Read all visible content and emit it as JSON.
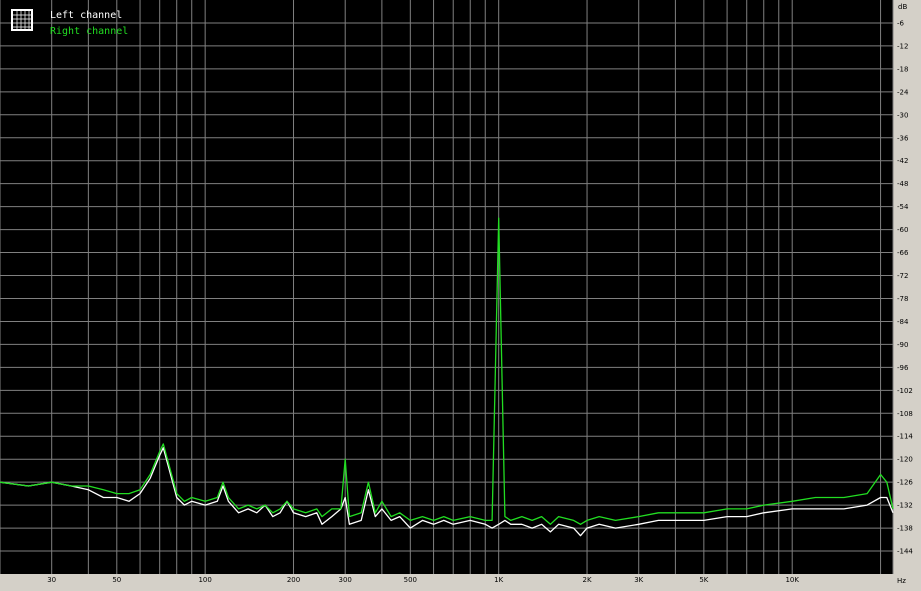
{
  "chart_data": {
    "type": "line",
    "y_unit": "dB",
    "x_unit": "Hz",
    "x_scale": "log",
    "xlim": [
      20,
      22050
    ],
    "ylim": [
      -150,
      0
    ],
    "y_ticks": [
      -6,
      -12,
      -18,
      -24,
      -30,
      -36,
      -42,
      -48,
      -54,
      -60,
      -66,
      -72,
      -78,
      -84,
      -90,
      -96,
      -102,
      -108,
      -114,
      -120,
      -126,
      -132,
      -138,
      -144
    ],
    "y_tick_labels": [
      "-6",
      "-12",
      "-18",
      "-24",
      "-30",
      "-36",
      "-42",
      "-48",
      "-54",
      "-60",
      "-66",
      "-72",
      "-78",
      "-84",
      "-90",
      "-96",
      "-102",
      "-108",
      "-114",
      "-120",
      "-126",
      "-132",
      "-138",
      "-144"
    ],
    "x_ticks": [
      30,
      50,
      100,
      200,
      300,
      500,
      1000,
      2000,
      3000,
      5000,
      10000
    ],
    "x_tick_labels": [
      "30",
      "50",
      "100",
      "200",
      "300",
      "500",
      "1K",
      "2K",
      "3K",
      "5K",
      "10K"
    ],
    "grid": true,
    "legend_position": "top-left",
    "colors": {
      "background": "#000000",
      "grid": "#808080",
      "left": "#ffffff",
      "right": "#22dd22",
      "frame": "#d4d0c8"
    },
    "series": [
      {
        "name": "Left channel",
        "color": "#ffffff",
        "points": [
          [
            20,
            -126
          ],
          [
            25,
            -127
          ],
          [
            30,
            -126
          ],
          [
            35,
            -127
          ],
          [
            40,
            -128
          ],
          [
            45,
            -130
          ],
          [
            50,
            -130
          ],
          [
            55,
            -131
          ],
          [
            60,
            -129
          ],
          [
            65,
            -125
          ],
          [
            70,
            -119
          ],
          [
            72,
            -117
          ],
          [
            75,
            -122
          ],
          [
            80,
            -130
          ],
          [
            85,
            -132
          ],
          [
            90,
            -131
          ],
          [
            100,
            -132
          ],
          [
            110,
            -131
          ],
          [
            115,
            -127
          ],
          [
            120,
            -131
          ],
          [
            130,
            -134
          ],
          [
            140,
            -133
          ],
          [
            150,
            -134
          ],
          [
            160,
            -132
          ],
          [
            170,
            -135
          ],
          [
            180,
            -134
          ],
          [
            190,
            -131
          ],
          [
            200,
            -134
          ],
          [
            220,
            -135
          ],
          [
            240,
            -134
          ],
          [
            250,
            -137
          ],
          [
            270,
            -135
          ],
          [
            290,
            -133
          ],
          [
            300,
            -130
          ],
          [
            310,
            -137
          ],
          [
            340,
            -136
          ],
          [
            360,
            -128
          ],
          [
            380,
            -135
          ],
          [
            400,
            -133
          ],
          [
            430,
            -136
          ],
          [
            460,
            -135
          ],
          [
            500,
            -138
          ],
          [
            550,
            -136
          ],
          [
            600,
            -137
          ],
          [
            650,
            -136
          ],
          [
            700,
            -137
          ],
          [
            800,
            -136
          ],
          [
            900,
            -137
          ],
          [
            950,
            -138
          ],
          [
            1000,
            -137
          ],
          [
            1050,
            -136
          ],
          [
            1100,
            -137
          ],
          [
            1200,
            -137
          ],
          [
            1300,
            -138
          ],
          [
            1400,
            -137
          ],
          [
            1500,
            -139
          ],
          [
            1600,
            -137
          ],
          [
            1800,
            -138
          ],
          [
            1900,
            -140
          ],
          [
            2000,
            -138
          ],
          [
            2200,
            -137
          ],
          [
            2500,
            -138
          ],
          [
            3000,
            -137
          ],
          [
            3500,
            -136
          ],
          [
            4000,
            -136
          ],
          [
            5000,
            -136
          ],
          [
            6000,
            -135
          ],
          [
            7000,
            -135
          ],
          [
            8000,
            -134
          ],
          [
            10000,
            -133
          ],
          [
            12000,
            -133
          ],
          [
            15000,
            -133
          ],
          [
            18000,
            -132
          ],
          [
            20000,
            -130
          ],
          [
            21000,
            -130
          ],
          [
            22050,
            -134
          ]
        ]
      },
      {
        "name": "Right channel",
        "color": "#22dd22",
        "points": [
          [
            20,
            -126
          ],
          [
            25,
            -127
          ],
          [
            30,
            -126
          ],
          [
            35,
            -127
          ],
          [
            40,
            -127
          ],
          [
            45,
            -128
          ],
          [
            50,
            -129
          ],
          [
            55,
            -129
          ],
          [
            60,
            -128
          ],
          [
            65,
            -124
          ],
          [
            70,
            -118
          ],
          [
            72,
            -116
          ],
          [
            75,
            -121
          ],
          [
            80,
            -129
          ],
          [
            85,
            -131
          ],
          [
            90,
            -130
          ],
          [
            100,
            -131
          ],
          [
            110,
            -130
          ],
          [
            115,
            -126
          ],
          [
            120,
            -130
          ],
          [
            130,
            -133
          ],
          [
            140,
            -132
          ],
          [
            150,
            -133
          ],
          [
            160,
            -132
          ],
          [
            170,
            -134
          ],
          [
            180,
            -133
          ],
          [
            190,
            -131
          ],
          [
            200,
            -133
          ],
          [
            220,
            -134
          ],
          [
            240,
            -133
          ],
          [
            250,
            -135
          ],
          [
            270,
            -133
          ],
          [
            290,
            -133
          ],
          [
            300,
            -120
          ],
          [
            310,
            -135
          ],
          [
            340,
            -134
          ],
          [
            360,
            -126
          ],
          [
            380,
            -134
          ],
          [
            400,
            -131
          ],
          [
            430,
            -135
          ],
          [
            460,
            -134
          ],
          [
            500,
            -136
          ],
          [
            550,
            -135
          ],
          [
            600,
            -136
          ],
          [
            650,
            -135
          ],
          [
            700,
            -136
          ],
          [
            800,
            -135
          ],
          [
            900,
            -136
          ],
          [
            950,
            -136
          ],
          [
            1000,
            -57
          ],
          [
            1050,
            -135
          ],
          [
            1100,
            -136
          ],
          [
            1200,
            -135
          ],
          [
            1300,
            -136
          ],
          [
            1400,
            -135
          ],
          [
            1500,
            -137
          ],
          [
            1600,
            -135
          ],
          [
            1800,
            -136
          ],
          [
            1900,
            -137
          ],
          [
            2000,
            -136
          ],
          [
            2200,
            -135
          ],
          [
            2500,
            -136
          ],
          [
            3000,
            -135
          ],
          [
            3500,
            -134
          ],
          [
            4000,
            -134
          ],
          [
            5000,
            -134
          ],
          [
            6000,
            -133
          ],
          [
            7000,
            -133
          ],
          [
            8000,
            -132
          ],
          [
            10000,
            -131
          ],
          [
            12000,
            -130
          ],
          [
            15000,
            -130
          ],
          [
            18000,
            -129
          ],
          [
            20000,
            -124
          ],
          [
            21000,
            -126
          ],
          [
            22050,
            -133
          ]
        ]
      }
    ]
  }
}
